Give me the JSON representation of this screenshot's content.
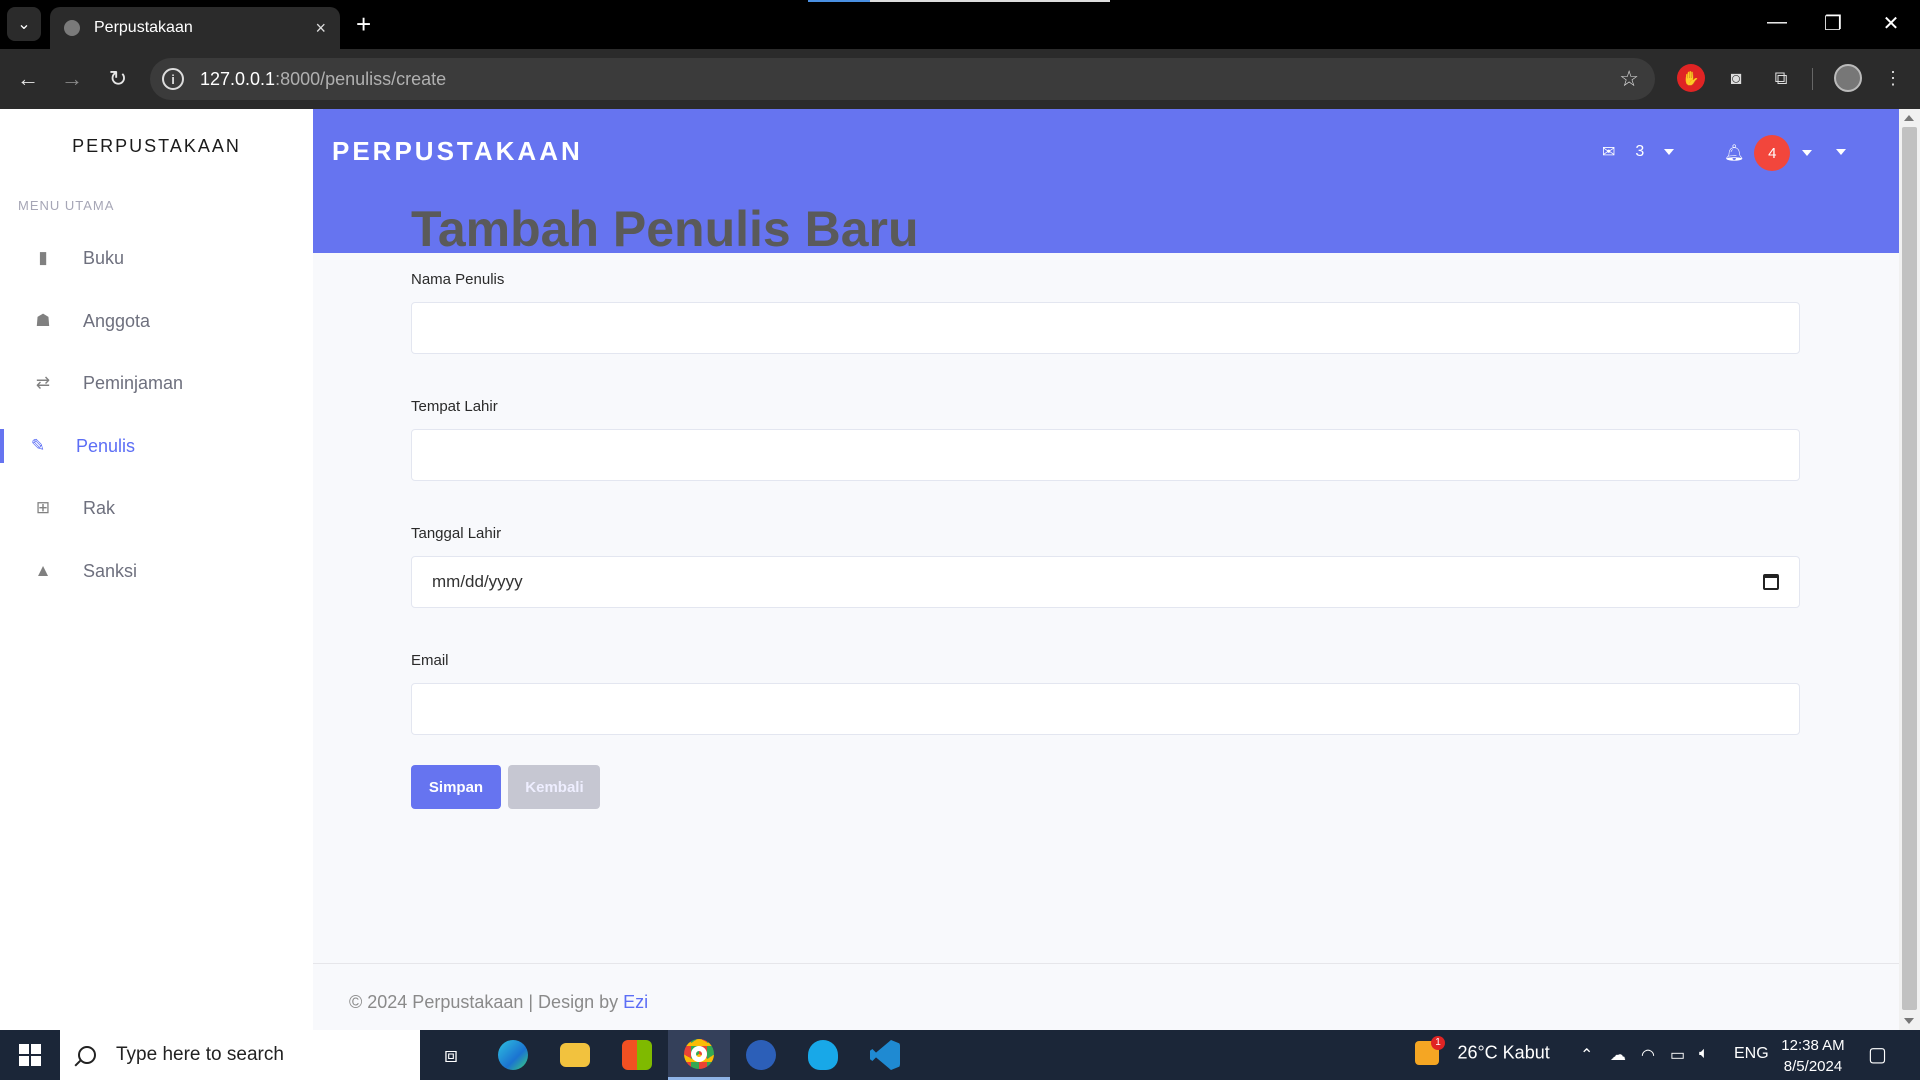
{
  "browser": {
    "tab_title": "Perpustakaan",
    "tab_close": "×",
    "new_tab": "+",
    "url_host": "127.0.0.1",
    "url_rest": ":8000/penuliss/create",
    "win_min": "—",
    "win_restore": "❐",
    "win_close": "✕"
  },
  "sidebar": {
    "brand": "PERPUSTAKAAN",
    "menu_heading": "MENU UTAMA",
    "items": [
      {
        "label": "Buku",
        "icon": "▮"
      },
      {
        "label": "Anggota",
        "icon": "☗"
      },
      {
        "label": "Peminjaman",
        "icon": "⇄"
      },
      {
        "label": "Penulis",
        "icon": "✎",
        "active": true
      },
      {
        "label": "Rak",
        "icon": "⊞"
      },
      {
        "label": "Sanksi",
        "icon": "▲"
      }
    ]
  },
  "topbar": {
    "brand": "PERPUSTAKAAN",
    "messages_count": "3",
    "alerts_count": "4"
  },
  "main": {
    "page_title": "Tambah Penulis Baru",
    "fields": [
      {
        "label": "Nama Penulis",
        "value": ""
      },
      {
        "label": "Tempat Lahir",
        "value": ""
      },
      {
        "label": "Tanggal Lahir",
        "value": "mm/dd/yyyy"
      },
      {
        "label": "Email",
        "value": ""
      }
    ],
    "save_button": "Simpan",
    "back_button": "Kembali"
  },
  "footer": {
    "text": "© 2024 Perpustakaan | Design by ",
    "link": "Ezi"
  },
  "taskbar": {
    "search_placeholder": "Type here to search",
    "weather": "26°C  Kabut",
    "weather_badge": "1",
    "language": "ENG",
    "time": "12:38 AM",
    "date": "8/5/2024"
  },
  "colors": {
    "accent": "#6674f0",
    "badge": "#f2463c",
    "active_nav": "#5c6ef5"
  }
}
